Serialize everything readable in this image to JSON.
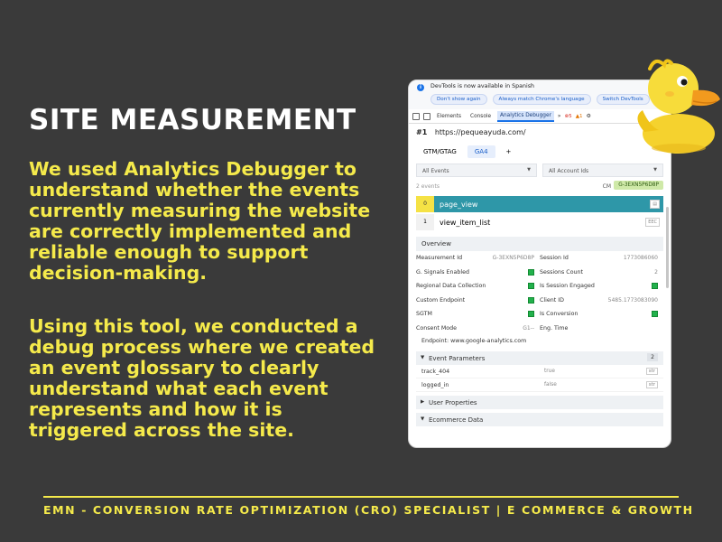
{
  "slide": {
    "title": "SITE MEASUREMENT",
    "paragraph1": "We used Analytics Debugger to understand whether the events currently measuring the website are correctly implemented and reliable enough to support decision-making.",
    "paragraph2": "Using this tool, we conducted a debug process where we created an event glossary to clearly understand what each event represents and how it is triggered across the site.",
    "footer": "EMN - CONVERSION RATE OPTIMIZATION (CRO) SPECIALIST | E COMMERCE & GROWTH",
    "accent_color": "#f5ea4b",
    "background_color": "#3a3a3a"
  },
  "devtools": {
    "banner_text": "DevTools is now available in Spanish",
    "banner_buttons": [
      "Don't show again",
      "Always match Chrome's language",
      "Switch DevTools"
    ],
    "tabs": [
      "Elements",
      "Console",
      "Analytics Debugger"
    ],
    "active_tab": "Analytics Debugger",
    "overflow": "»",
    "error_count": "5",
    "warning_count": "1"
  },
  "debugger": {
    "page_num": "#1",
    "url": "https://pequeayuda.com/",
    "tabs": [
      "GTM/GTAG",
      "GA4"
    ],
    "add_tab": "+",
    "filter_events": "All Events",
    "filter_accounts": "All Account Ids",
    "events_count": "2 events",
    "cm_label": "CM",
    "measurement_badge": "G-3EXN5P6D8P",
    "events": [
      {
        "index": "0",
        "name": "page_view",
        "active": true
      },
      {
        "index": "1",
        "name": "view_item_list",
        "badge": "EEC"
      }
    ],
    "overview_label": "Overview",
    "overview_rows": [
      {
        "l1": "Measurement Id",
        "v1": "G-3EXN5P6D8P",
        "l2": "Session Id",
        "v2": "1773086060"
      },
      {
        "l1": "G. Signals Enabled",
        "l2": "Sessions Count",
        "v2": "2"
      },
      {
        "l1": "Regional Data Collection",
        "l2": "Is Session Engaged"
      },
      {
        "l1": "Custom Endpoint",
        "l2": "Client ID",
        "v2": "5485.1773083090"
      },
      {
        "l1": "SGTM",
        "l2": "Is Conversion"
      },
      {
        "l1": "Consent Mode",
        "v1": "G1--",
        "l2": "Eng. Time"
      }
    ],
    "endpoint": "Endpoint: www.google-analytics.com",
    "event_params_label": "Event Parameters",
    "event_params_count": "2",
    "params": [
      {
        "name": "track_404",
        "value": "true",
        "type": "str"
      },
      {
        "name": "logged_in",
        "value": "false",
        "type": "str"
      }
    ],
    "user_props_label": "User Properties",
    "ecommerce_label": "Ecommerce Data"
  }
}
